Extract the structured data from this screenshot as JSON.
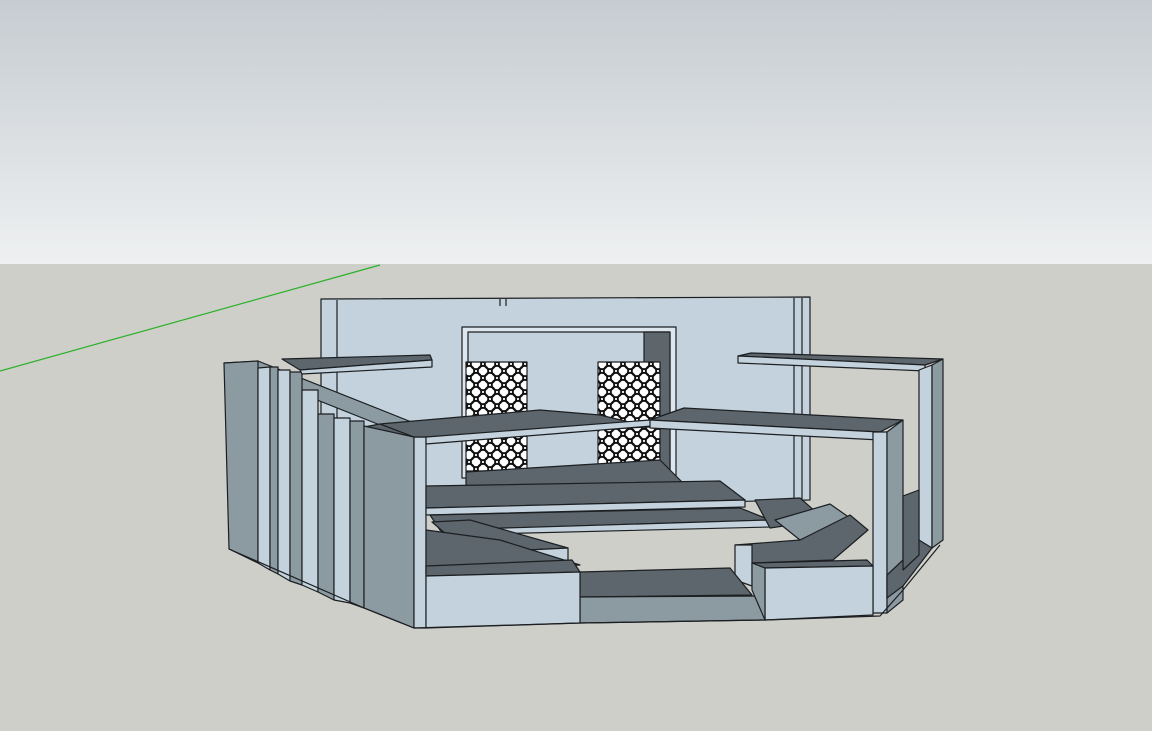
{
  "colors": {
    "sky_top": "#c6ccd1",
    "sky_bottom": "#eef0f1",
    "ground": "#cfcfca",
    "face_light": "#c3d2dc",
    "face_mid": "#8c9aa2",
    "face_dark": "#5c666c",
    "edge": "#1c1f22",
    "axis_green": "#2bb12b"
  },
  "scene": {
    "model": "stage-set",
    "screen_pattern": "geometric-lattice"
  }
}
